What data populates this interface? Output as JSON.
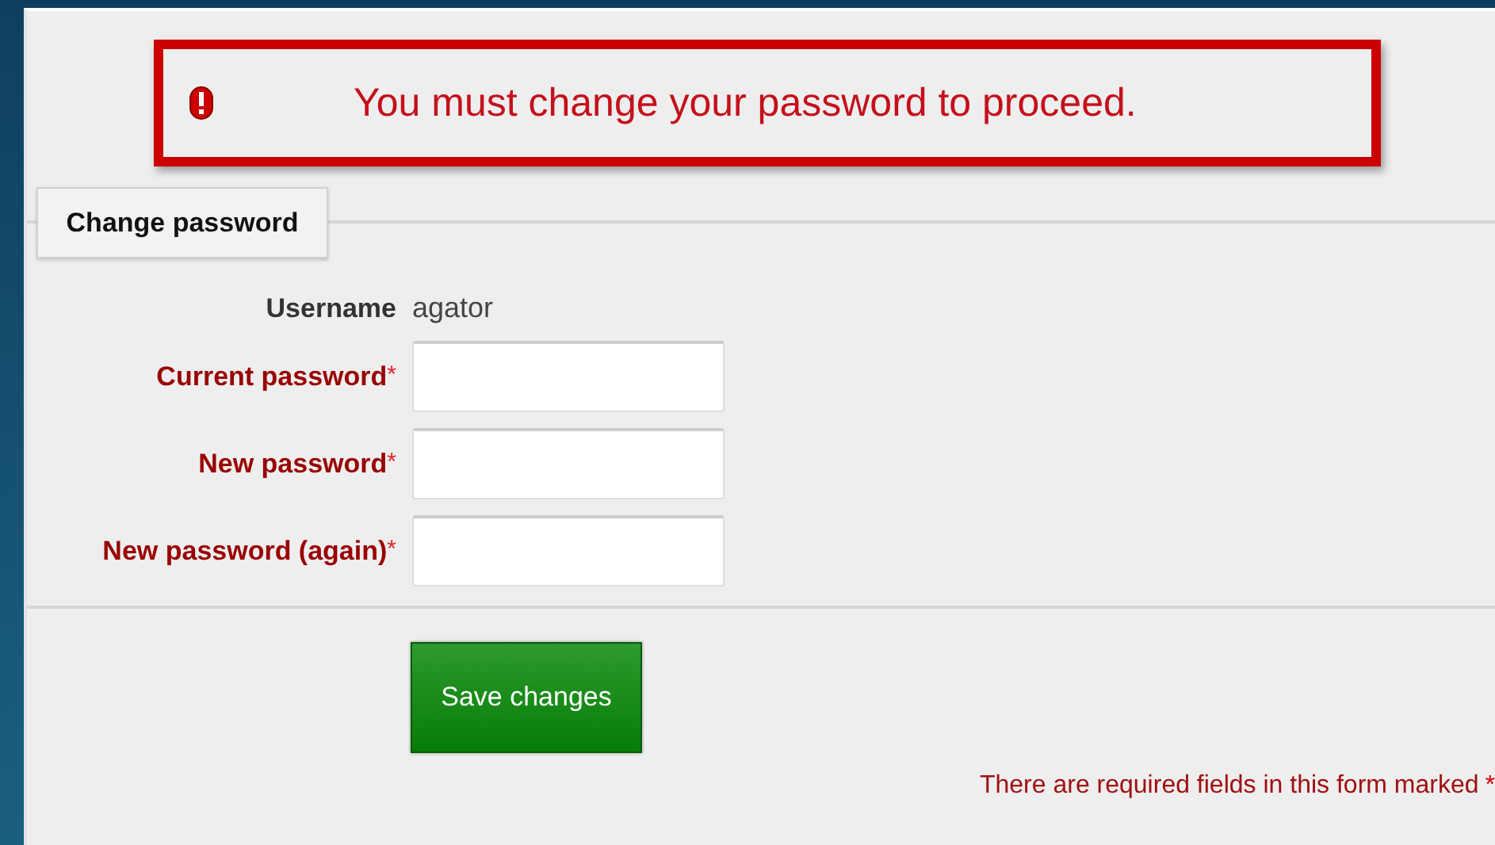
{
  "alert": {
    "message": "You must change your password to proceed."
  },
  "section": {
    "legend": "Change password"
  },
  "username": {
    "label": "Username",
    "value": "agator"
  },
  "fields": [
    {
      "label": "Current password",
      "marker": "*",
      "required": true
    },
    {
      "label": "New password",
      "marker": "*",
      "required": true
    },
    {
      "label": "New password (again)",
      "marker": "*",
      "required": true
    }
  ],
  "submit": {
    "label": "Save changes"
  },
  "footer": {
    "note": "There are required fields in this form marked",
    "marker": "*"
  }
}
